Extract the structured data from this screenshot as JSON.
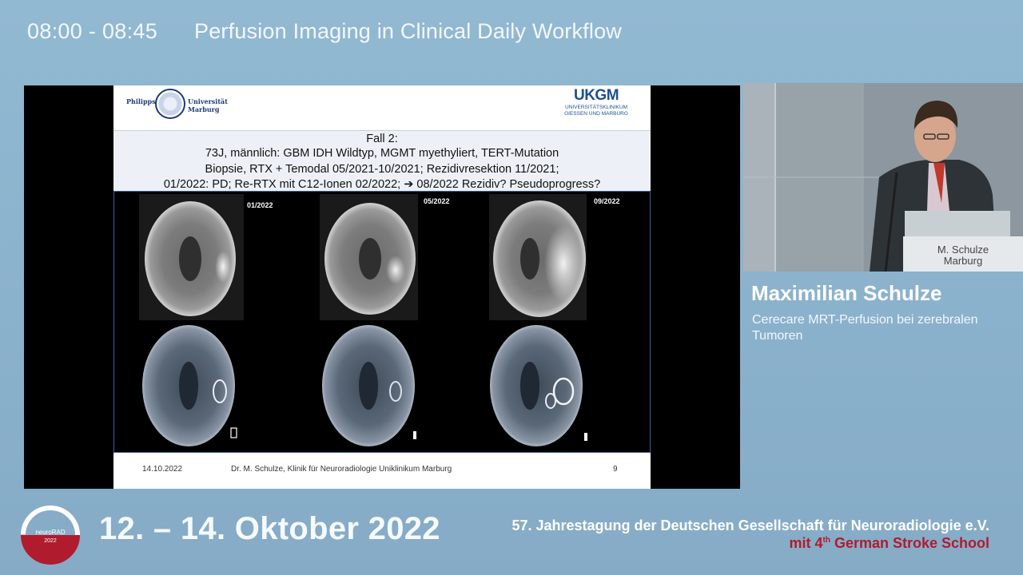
{
  "session": {
    "time": "08:00 - 08:45",
    "title": "Perfusion Imaging in Clinical Daily Workflow"
  },
  "slide": {
    "logo_left": {
      "left_text": "Philipps",
      "right_line1": "Universität",
      "right_line2": "Marburg"
    },
    "logo_right": {
      "main": "UKGM",
      "sub1": "UNIVERSITÄTSKLINIKUM",
      "sub2": "GIESSEN UND MARBURG"
    },
    "case_lines": [
      "Fall 2:",
      "73J, männlich: GBM IDH Wildtyp, MGMT myethyliert, TERT-Mutation",
      "Biopsie, RTX + Temodal 05/2021-10/2021; Rezidivresektion 11/2021;",
      "01/2022: PD; Re-RTX mit C12-Ionen 02/2022;  ➔ 08/2022 Rezidiv? Pseudoprogress?"
    ],
    "dates": [
      "01/2022",
      "05/2022",
      "09/2022"
    ],
    "footer": {
      "date": "14.10.2022",
      "author": "Dr. M. Schulze,  Klinik für Neuroradiologie Uniklinikum Marburg",
      "page": "9"
    }
  },
  "speaker": {
    "name": "Maximilian Schulze",
    "talk_title": "Cerecare MRT-Perfusion bei zerebralen Tumoren",
    "lectern_sign_line1": "M. Schulze",
    "lectern_sign_line2": "Marburg"
  },
  "conference": {
    "logo_line1": "neuroRAD",
    "logo_line2": "2022",
    "dates": "12. – 14. Oktober 2022",
    "name": "57. Jahrestagung der Deutschen Gesellschaft für Neuroradiologie e.V.",
    "stroke_prefix": "mit 4",
    "stroke_sup": "th",
    "stroke_suffix": " German Stroke School"
  },
  "colors": {
    "background": "#8cb3cd",
    "accent_red": "#b11b2e",
    "slide_blue": "#1e4f8d"
  }
}
